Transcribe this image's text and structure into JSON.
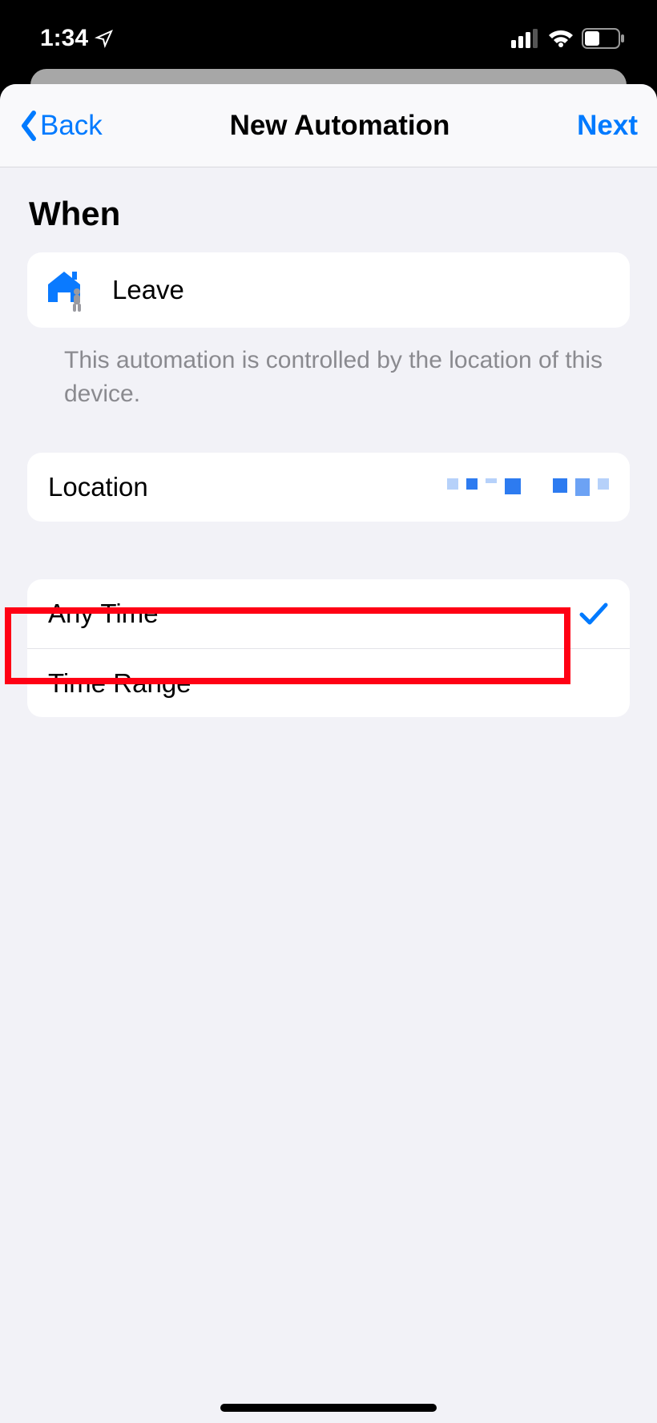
{
  "status": {
    "time": "1:34"
  },
  "nav": {
    "back": "Back",
    "title": "New Automation",
    "next": "Next"
  },
  "section": {
    "title": "When"
  },
  "trigger": {
    "label": "Leave",
    "footnote": "This automation is controlled by the location of this device."
  },
  "location": {
    "label": "Location"
  },
  "time_options": {
    "any": "Any Time",
    "range": "Time Range",
    "selected": "any"
  }
}
